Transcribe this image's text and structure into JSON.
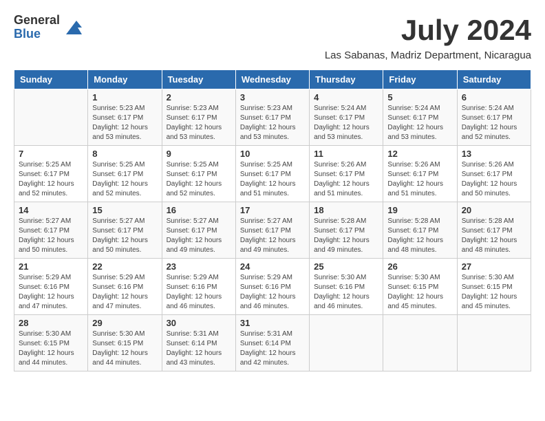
{
  "header": {
    "logo_general": "General",
    "logo_blue": "Blue",
    "month_title": "July 2024",
    "subtitle": "Las Sabanas, Madriz Department, Nicaragua"
  },
  "days_of_week": [
    "Sunday",
    "Monday",
    "Tuesday",
    "Wednesday",
    "Thursday",
    "Friday",
    "Saturday"
  ],
  "weeks": [
    [
      {
        "day": "",
        "info": ""
      },
      {
        "day": "1",
        "info": "Sunrise: 5:23 AM\nSunset: 6:17 PM\nDaylight: 12 hours\nand 53 minutes."
      },
      {
        "day": "2",
        "info": "Sunrise: 5:23 AM\nSunset: 6:17 PM\nDaylight: 12 hours\nand 53 minutes."
      },
      {
        "day": "3",
        "info": "Sunrise: 5:23 AM\nSunset: 6:17 PM\nDaylight: 12 hours\nand 53 minutes."
      },
      {
        "day": "4",
        "info": "Sunrise: 5:24 AM\nSunset: 6:17 PM\nDaylight: 12 hours\nand 53 minutes."
      },
      {
        "day": "5",
        "info": "Sunrise: 5:24 AM\nSunset: 6:17 PM\nDaylight: 12 hours\nand 53 minutes."
      },
      {
        "day": "6",
        "info": "Sunrise: 5:24 AM\nSunset: 6:17 PM\nDaylight: 12 hours\nand 52 minutes."
      }
    ],
    [
      {
        "day": "7",
        "info": "Sunrise: 5:25 AM\nSunset: 6:17 PM\nDaylight: 12 hours\nand 52 minutes."
      },
      {
        "day": "8",
        "info": "Sunrise: 5:25 AM\nSunset: 6:17 PM\nDaylight: 12 hours\nand 52 minutes."
      },
      {
        "day": "9",
        "info": "Sunrise: 5:25 AM\nSunset: 6:17 PM\nDaylight: 12 hours\nand 52 minutes."
      },
      {
        "day": "10",
        "info": "Sunrise: 5:25 AM\nSunset: 6:17 PM\nDaylight: 12 hours\nand 51 minutes."
      },
      {
        "day": "11",
        "info": "Sunrise: 5:26 AM\nSunset: 6:17 PM\nDaylight: 12 hours\nand 51 minutes."
      },
      {
        "day": "12",
        "info": "Sunrise: 5:26 AM\nSunset: 6:17 PM\nDaylight: 12 hours\nand 51 minutes."
      },
      {
        "day": "13",
        "info": "Sunrise: 5:26 AM\nSunset: 6:17 PM\nDaylight: 12 hours\nand 50 minutes."
      }
    ],
    [
      {
        "day": "14",
        "info": "Sunrise: 5:27 AM\nSunset: 6:17 PM\nDaylight: 12 hours\nand 50 minutes."
      },
      {
        "day": "15",
        "info": "Sunrise: 5:27 AM\nSunset: 6:17 PM\nDaylight: 12 hours\nand 50 minutes."
      },
      {
        "day": "16",
        "info": "Sunrise: 5:27 AM\nSunset: 6:17 PM\nDaylight: 12 hours\nand 49 minutes."
      },
      {
        "day": "17",
        "info": "Sunrise: 5:27 AM\nSunset: 6:17 PM\nDaylight: 12 hours\nand 49 minutes."
      },
      {
        "day": "18",
        "info": "Sunrise: 5:28 AM\nSunset: 6:17 PM\nDaylight: 12 hours\nand 49 minutes."
      },
      {
        "day": "19",
        "info": "Sunrise: 5:28 AM\nSunset: 6:17 PM\nDaylight: 12 hours\nand 48 minutes."
      },
      {
        "day": "20",
        "info": "Sunrise: 5:28 AM\nSunset: 6:17 PM\nDaylight: 12 hours\nand 48 minutes."
      }
    ],
    [
      {
        "day": "21",
        "info": "Sunrise: 5:29 AM\nSunset: 6:16 PM\nDaylight: 12 hours\nand 47 minutes."
      },
      {
        "day": "22",
        "info": "Sunrise: 5:29 AM\nSunset: 6:16 PM\nDaylight: 12 hours\nand 47 minutes."
      },
      {
        "day": "23",
        "info": "Sunrise: 5:29 AM\nSunset: 6:16 PM\nDaylight: 12 hours\nand 46 minutes."
      },
      {
        "day": "24",
        "info": "Sunrise: 5:29 AM\nSunset: 6:16 PM\nDaylight: 12 hours\nand 46 minutes."
      },
      {
        "day": "25",
        "info": "Sunrise: 5:30 AM\nSunset: 6:16 PM\nDaylight: 12 hours\nand 46 minutes."
      },
      {
        "day": "26",
        "info": "Sunrise: 5:30 AM\nSunset: 6:15 PM\nDaylight: 12 hours\nand 45 minutes."
      },
      {
        "day": "27",
        "info": "Sunrise: 5:30 AM\nSunset: 6:15 PM\nDaylight: 12 hours\nand 45 minutes."
      }
    ],
    [
      {
        "day": "28",
        "info": "Sunrise: 5:30 AM\nSunset: 6:15 PM\nDaylight: 12 hours\nand 44 minutes."
      },
      {
        "day": "29",
        "info": "Sunrise: 5:30 AM\nSunset: 6:15 PM\nDaylight: 12 hours\nand 44 minutes."
      },
      {
        "day": "30",
        "info": "Sunrise: 5:31 AM\nSunset: 6:14 PM\nDaylight: 12 hours\nand 43 minutes."
      },
      {
        "day": "31",
        "info": "Sunrise: 5:31 AM\nSunset: 6:14 PM\nDaylight: 12 hours\nand 42 minutes."
      },
      {
        "day": "",
        "info": ""
      },
      {
        "day": "",
        "info": ""
      },
      {
        "day": "",
        "info": ""
      }
    ]
  ]
}
